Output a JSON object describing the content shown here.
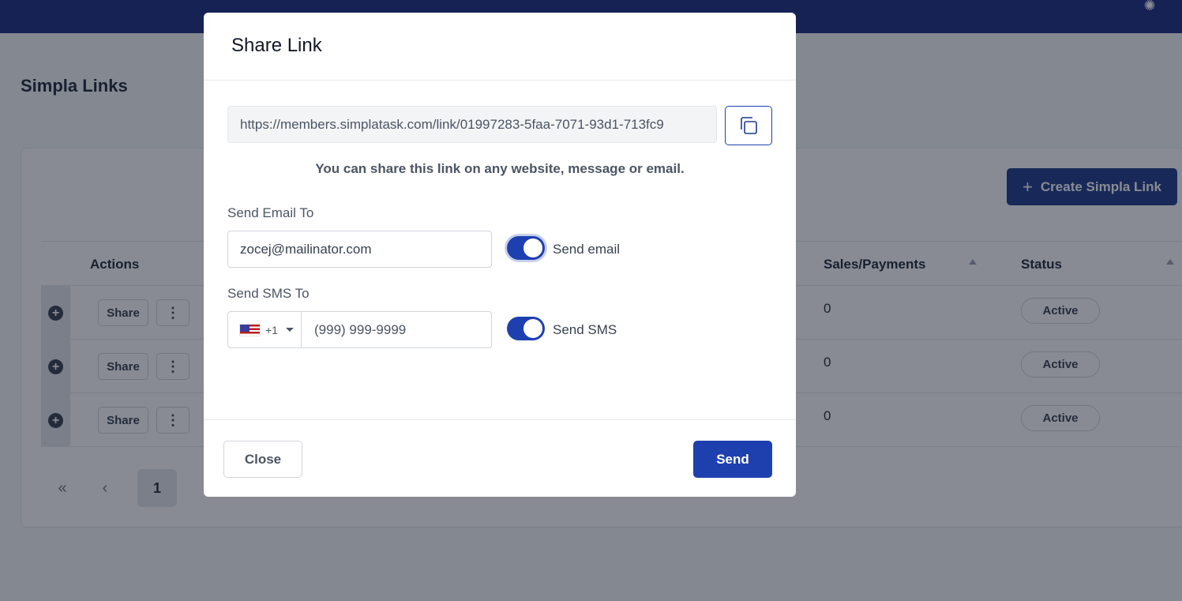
{
  "background": {
    "page_title": "Simpla Links",
    "create_button_label": "Create Simpla Link",
    "table": {
      "headers": {
        "actions": "Actions",
        "sales": "Sales/Payments",
        "status": "Status"
      },
      "rows": [
        {
          "share_label": "Share",
          "sales": "0",
          "status": "Active"
        },
        {
          "share_label": "Share",
          "sales": "0",
          "status": "Active"
        },
        {
          "share_label": "Share",
          "sales": "0",
          "status": "Active"
        }
      ]
    },
    "pagination": {
      "first": "«",
      "prev": "‹",
      "current_page": "1"
    }
  },
  "modal": {
    "title": "Share Link",
    "link_url": "https://members.simplatask.com/link/01997283-5faa-7071-93d1-713fc9",
    "helper_text": "You can share this link on any website, message or email.",
    "email": {
      "label": "Send Email To",
      "value": "zocej@mailinator.com",
      "toggle_label": "Send email",
      "toggle_on": true
    },
    "sms": {
      "label": "Send SMS To",
      "country_code": "+1",
      "placeholder": "(999) 999-9999",
      "toggle_label": "Send SMS",
      "toggle_on": true
    },
    "close_label": "Close",
    "send_label": "Send"
  },
  "colors": {
    "primary": "#1e40af",
    "topbar": "#1b2a80"
  }
}
